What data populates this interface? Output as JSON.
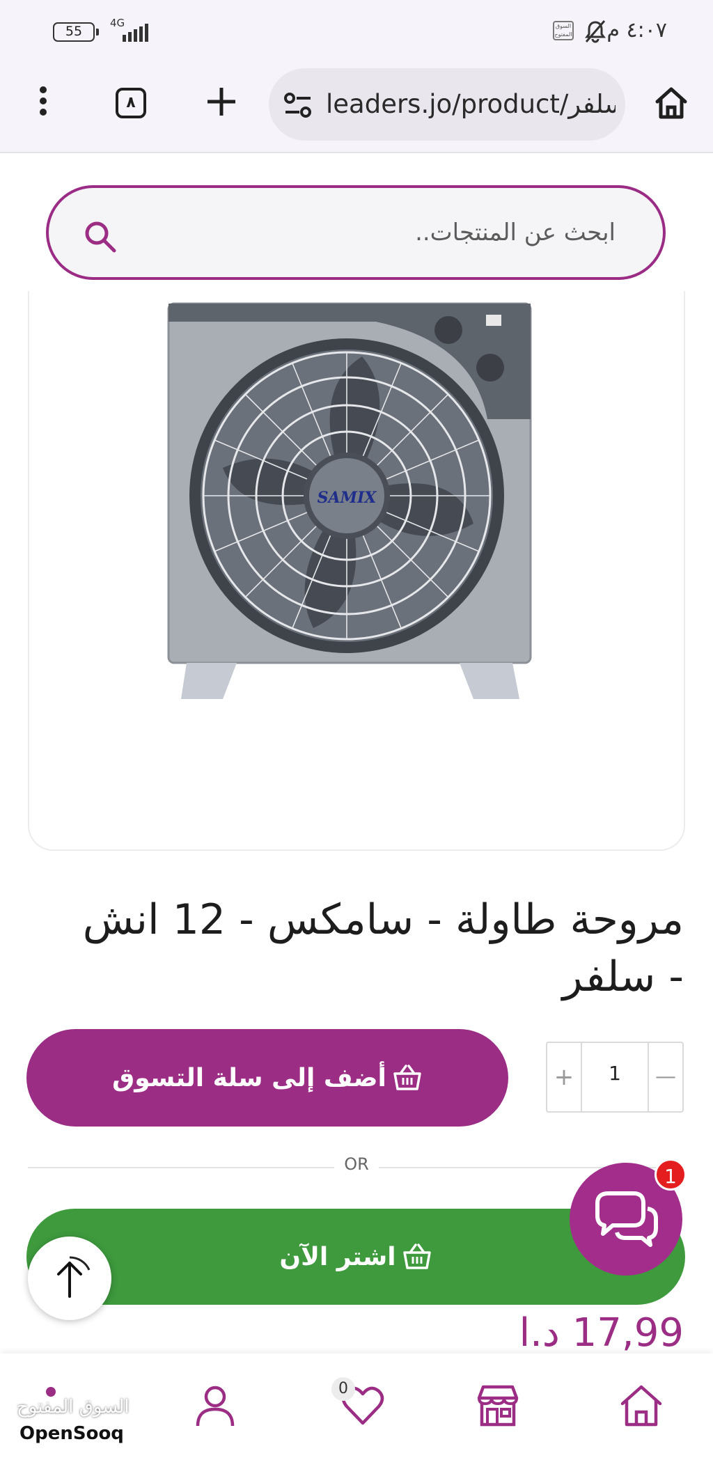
{
  "status_bar": {
    "time": "٤:٠٧ م",
    "battery": "55",
    "network": "4G",
    "app_icon": "السوق المفتوح"
  },
  "browser": {
    "url": "leaders.jo/product/سلفر",
    "tab_count": "٨"
  },
  "search": {
    "placeholder": "ابحث عن المنتجات.."
  },
  "product": {
    "title": "مروحة طاولة - سامكس - 12 انش - سلفر",
    "brand_on_image": "SAMIX",
    "quantity": "1",
    "price": "17,99 د.ا"
  },
  "actions": {
    "add_to_cart": "أضف إلى سلة التسوق",
    "or_label": "OR",
    "buy_now": "اشتر الآن",
    "chat_badge": "1",
    "qty_plus": "+",
    "qty_minus": "—"
  },
  "bottom_nav": {
    "wishlist_count": "0",
    "watermark_arabic": "السوق المفتوح",
    "watermark_latin": "OpenSooq"
  },
  "colors": {
    "brand_purple": "#9b2d84",
    "buy_green": "#3e9a3d",
    "badge_red": "#e41e1e"
  },
  "icons": {
    "home": "home-icon",
    "tune": "site-settings-icon",
    "search": "search-icon",
    "cart": "basket-icon",
    "chat": "chat-bubbles-icon",
    "arrow_up": "arrow-up-icon",
    "account": "user-icon",
    "wishlist": "heart-icon",
    "store": "store-icon"
  }
}
